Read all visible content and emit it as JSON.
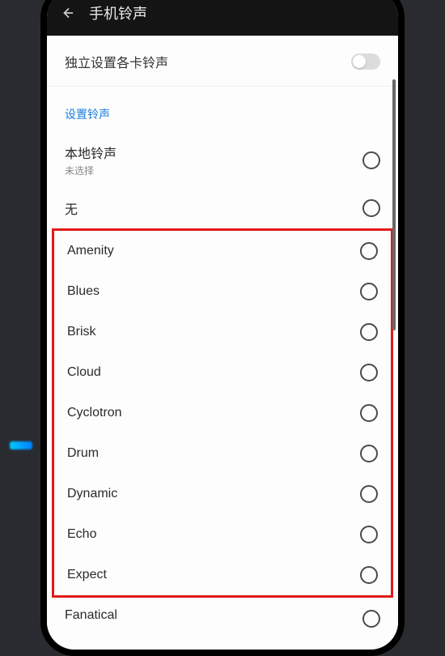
{
  "header": {
    "title": "手机铃声"
  },
  "topSetting": {
    "label": "独立设置各卡铃声"
  },
  "sectionTitle": "设置铃声",
  "localRingtone": {
    "title": "本地铃声",
    "subtitle": "未选择"
  },
  "noneLabel": "无",
  "ringtones": [
    "Amenity",
    "Blues",
    "Brisk",
    "Cloud",
    "Cyclotron",
    "Drum",
    "Dynamic",
    "Echo",
    "Expect"
  ],
  "lastItem": "Fanatical"
}
